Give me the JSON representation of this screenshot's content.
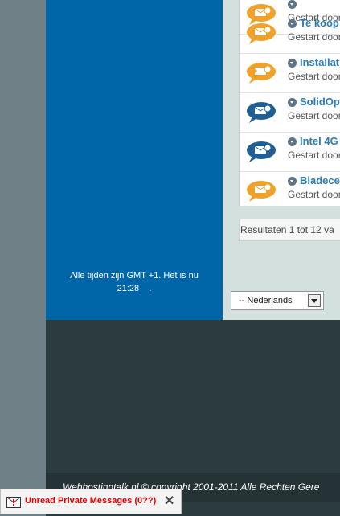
{
  "threads": [
    {
      "title": "",
      "meta": "Gestart door",
      "icon": "orange-speech-bubble-icon",
      "color": "#f0a12a"
    },
    {
      "title": "Te koop",
      "meta": "Gestart door",
      "icon": "orange-speech-bubble-icon",
      "color": "#f0a12a"
    },
    {
      "title": "Installat",
      "meta": "Gestart door",
      "icon": "orange-speech-bubble-icon",
      "color": "#f0a12a"
    },
    {
      "title": "SolidOp",
      "meta": "Gestart door",
      "icon": "blue-speech-bubble-icon",
      "color": "#1f5f96"
    },
    {
      "title": "Intel 4G",
      "meta": "Gestart door",
      "icon": "blue-speech-bubble-icon",
      "color": "#1f5f96"
    },
    {
      "title": "Bladece",
      "meta": "Gestart door",
      "icon": "orange-speech-bubble-icon",
      "color": "#f0a12a"
    }
  ],
  "results_text": "Resultaten 1 tot 12 va",
  "timezone": {
    "line1": "Alle tijden zijn GMT +1. Het is nu",
    "time": "21:28",
    "suffix": "."
  },
  "language": {
    "selected": "-- Nederlands"
  },
  "footer": {
    "copyright": "Webhostingtalk.nl © copyright 2001-2011 Alle Rechten Gere"
  },
  "pm_bar": {
    "text": "Unread Private Messages (0??)",
    "close": "✕"
  }
}
